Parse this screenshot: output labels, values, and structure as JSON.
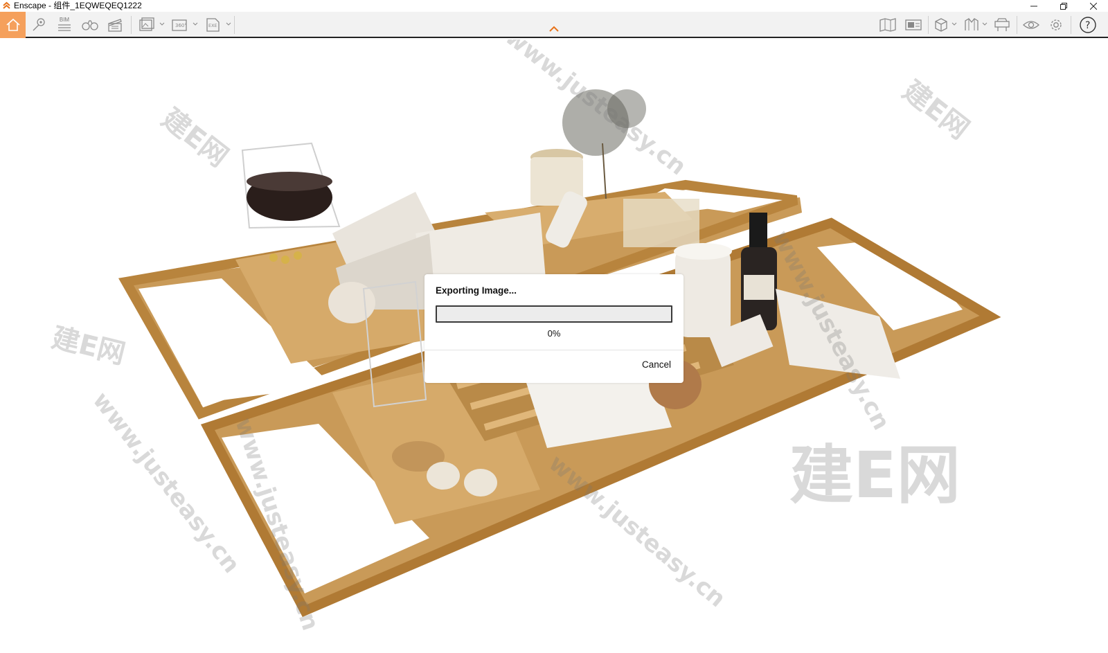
{
  "window": {
    "title": "Enscape - 组件_1EQWEQEQ1222",
    "controls": [
      "minimize-icon",
      "restore-icon",
      "close-icon"
    ]
  },
  "toolbar": {
    "bim_label": "BIM",
    "icons_left": [
      "home-icon",
      "pin-icon",
      "bim-icon",
      "binoculars-icon",
      "clapperboard-icon",
      "batch-render-icon",
      "panorama-360-icon",
      "export-exe-icon"
    ],
    "icons_right": [
      "map-icon",
      "screenshot-icon",
      "cube-icon",
      "manage-views-icon",
      "asset-library-icon",
      "visual-settings-icon",
      "settings-icon",
      "help-icon"
    ],
    "home_color": "#f5a05c",
    "collapse_arrow_color": "#e8731a"
  },
  "dialog": {
    "title": "Exporting Image...",
    "progress": 0,
    "progress_text": "0%",
    "cancel_label": "Cancel"
  },
  "watermarks": [
    "建E网",
    "www.justeasy.cn"
  ]
}
